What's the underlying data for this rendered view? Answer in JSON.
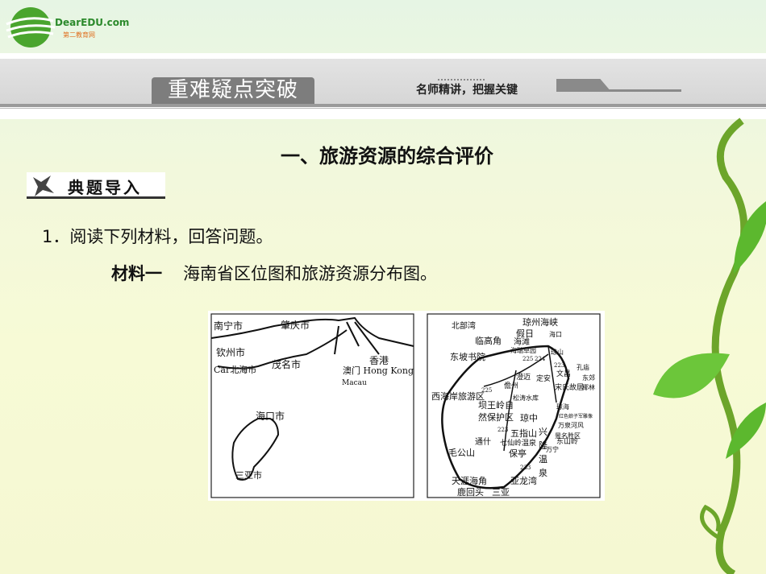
{
  "logo": {
    "brand": "DearEDU.com",
    "sub": "第二教育网"
  },
  "header": {
    "section_tab": "重难疑点突破",
    "subtitle": "名师精讲，把握关键"
  },
  "heading": "一、旅游资源的综合评价",
  "section_label": "典题导入",
  "question": "1．阅读下列材料，回答问题。",
  "material": {
    "label": "材料一",
    "text": "海南省区位图和旅游资源分布图。"
  },
  "map_left_labels": [
    "南宁市",
    "肇庆市",
    "钦州市",
    "Car北海市",
    "茂名市",
    "香港",
    "澳门 Hong Kong",
    "Macau",
    "海口市",
    "三亚市"
  ],
  "map_right_labels": [
    "北部湾",
    "琼州海峡",
    "假日",
    "海滩",
    "海瑞草园",
    "海口",
    "临高角",
    "琼山",
    "东坡书院",
    "225",
    "224",
    "223",
    "孔庙",
    "文昌",
    "澄迈",
    "定安",
    "儋州",
    "东郊",
    "椰林",
    "宋氏故居",
    "225",
    "西海岸旅游区",
    "松涛水库",
    "坝王岭自",
    "然保护区",
    "琼海",
    "红色娘子军雕像",
    "琼中",
    "万泉河风",
    "景名胜区",
    "223",
    "五指山",
    "七仙岭温泉",
    "东山岭",
    "通什",
    "万宁",
    "保亭",
    "毛公山",
    "兴",
    "隆",
    "温",
    "泉",
    "233",
    "天涯海角",
    "亚龙湾",
    "鹿回头",
    "三亚"
  ]
}
